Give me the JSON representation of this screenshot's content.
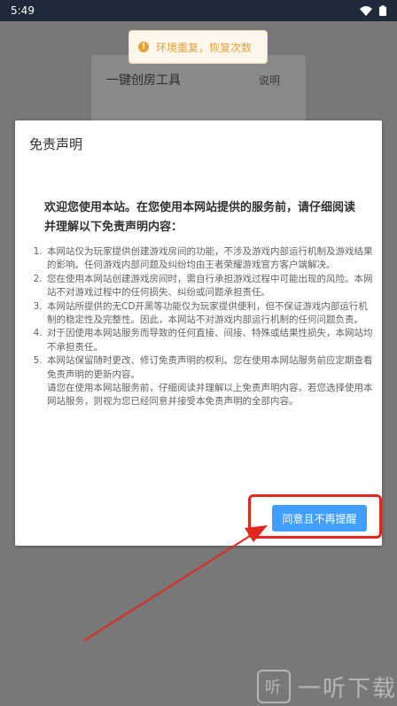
{
  "status_bar": {
    "time": "5:49",
    "wifi_icon": "wifi-icon",
    "battery_icon": "battery-icon"
  },
  "background_page": {
    "title": "一键创房工具",
    "link": "说明"
  },
  "toast": {
    "icon": "warning-icon",
    "message": "环境重复，恢复次数"
  },
  "dialog": {
    "title": "免责声明",
    "heading": "欢迎您使用本站。在您使用本网站提供的服务前，请仔细阅读并理解以下免责声明内容：",
    "items": [
      "本网站仅为玩家提供创建游戏房间的功能，不涉及游戏内部运行机制及游戏结果的影响。任何游戏内部问题及纠纷均由王者荣耀游戏官方客户端解决。",
      "您在使用本网站创建游戏房间时，需自行承担游戏过程中可能出现的风险。本网站不对游戏过程中的任何损失、纠纷或问题承担责任。",
      "本网站所提供的无CD开黑等功能仅为玩家提供便利，但不保证游戏内部运行机制的稳定性及完整性。因此，本网站不对游戏内部运行机制的任何问题负责。",
      "对于因使用本网站服务而导致的任何直接、间接、特殊或结果性损失，本网站均不承担责任。",
      "本网站保留随时更改、修订免责声明的权利。您在使用本网站服务前应定期查看免责声明的更新内容。"
    ],
    "closing": "请您在使用本网站服务前，仔细阅读并理解以上免责声明内容。若您选择使用本网站服务，则视为您已经同意并接受本免责声明的全部内容。",
    "confirm_button": "同意且不再提醒"
  },
  "watermark": {
    "logo_glyph": "听",
    "text": "一听下载"
  },
  "colors": {
    "primary": "#409eff",
    "highlight": "#e0281c",
    "toast_text": "#e6a23c"
  }
}
